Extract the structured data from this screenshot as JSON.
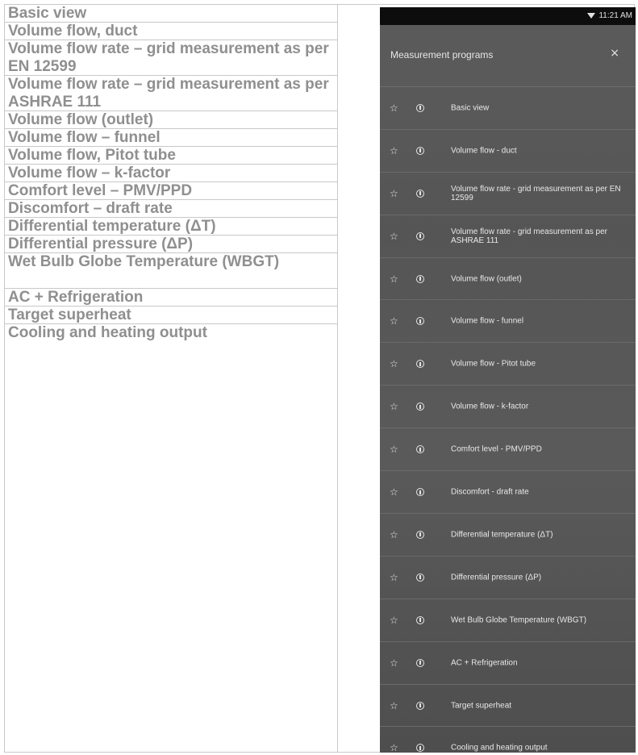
{
  "table": {
    "rows": [
      "Basic view",
      "Volume flow, duct",
      "Volume flow rate – grid measurement as per EN 12599",
      "Volume flow rate – grid measurement as per ASHRAE 111",
      "Volume flow (outlet)",
      "Volume flow – funnel",
      "Volume flow, Pitot tube",
      "Volume flow – k-factor",
      "Comfort level – PMV/PPD",
      "Discomfort – draft rate",
      "Differential temperature (ΔT)",
      "Differential pressure (ΔP)",
      "Wet Bulb Globe Temperature (WBGT)",
      "AC + Refrigeration",
      "Target superheat",
      "Cooling and heating output"
    ]
  },
  "phone": {
    "status_time": "11:21 AM",
    "header_title": "Measurement programs",
    "close_glyph": "×",
    "star_glyph": "☆",
    "items": [
      "Basic view",
      "Volume flow - duct",
      "Volume flow rate - grid measurement as per EN 12599",
      "Volume flow rate - grid measurement as per ASHRAE 111",
      "Volume flow (outlet)",
      "Volume flow - funnel",
      "Volume flow - Pitot tube",
      "Volume flow - k-factor",
      "Comfort level - PMV/PPD",
      "Discomfort - draft rate",
      "Differential temperature (ΔT)",
      "Differential pressure (ΔP)",
      "Wet Bulb Globe Temperature (WBGT)",
      "AC + Refrigeration",
      "Target superheat",
      "Cooling and heating output"
    ]
  },
  "colors": {
    "table_text": "#8f8f8f",
    "table_border": "#c8c8c8",
    "status_bar": "#0d0d0d",
    "phone_bg": "#555555",
    "phone_text": "#e8e8e8"
  }
}
